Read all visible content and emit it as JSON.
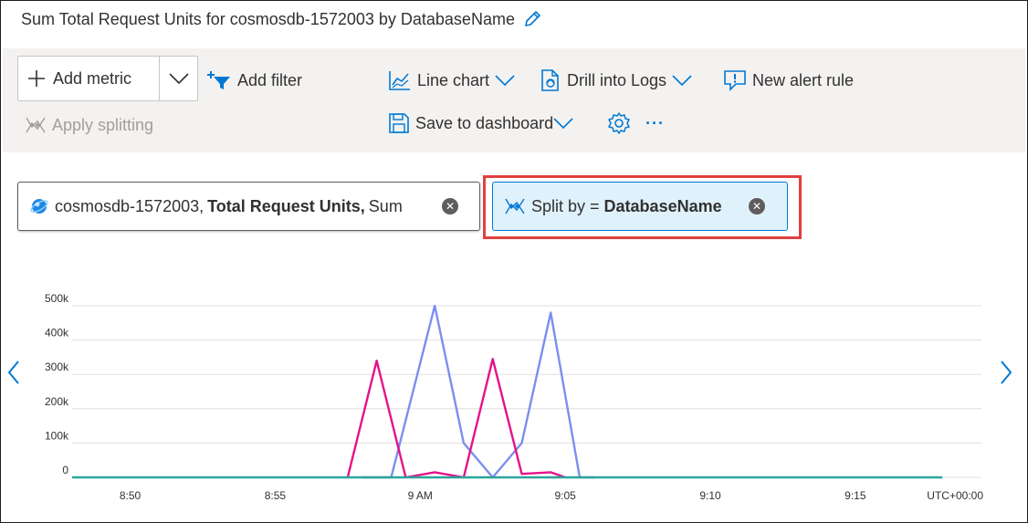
{
  "title": "Sum Total Request Units for cosmosdb-1572003 by DatabaseName",
  "toolbar": {
    "add_metric": "Add metric",
    "add_filter": "Add filter",
    "apply_splitting": "Apply splitting",
    "line_chart": "Line chart",
    "drill_into_logs": "Drill into Logs",
    "new_alert_rule": "New alert rule",
    "save_to_dashboard": "Save to dashboard",
    "more": "···"
  },
  "metric_pill": {
    "resource": "cosmosdb-1572003,",
    "metric": "Total Request Units,",
    "aggregation": "Sum"
  },
  "split_pill": {
    "prefix": "Split by =",
    "value": "DatabaseName"
  },
  "colors": {
    "accent": "#0078d4",
    "highlight": "#e0403f",
    "series_blue": "#7b8ff0",
    "series_pink": "#e3138a",
    "series_teal": "#2aa59a"
  },
  "chart_data": {
    "type": "line",
    "x": [
      "8:48",
      "8:51",
      "8:54",
      "8:57",
      "8:58",
      "8:59",
      "9:00",
      "9:01",
      "9:02",
      "9:03",
      "9:04",
      "9:05",
      "9:06",
      "9:09",
      "9:12",
      "9:15",
      "9:18"
    ],
    "x_tick_labels": [
      "8:50",
      "8:55",
      "9 AM",
      "9:05",
      "9:10",
      "9:15"
    ],
    "x_tick_positions": [
      "8:50",
      "8:55",
      "9:00",
      "9:05",
      "9:10",
      "9:15"
    ],
    "timezone_label": "UTC+00:00",
    "y_tick_labels": [
      "500k",
      "400k",
      "300k",
      "200k",
      "100k",
      "0"
    ],
    "ylim": [
      0,
      500000
    ],
    "grid": true,
    "series": [
      {
        "color": "#7b8ff0",
        "points": [
          [
            "8:58",
            0
          ],
          [
            "8:59",
            0
          ],
          [
            "9:00.5",
            500000
          ],
          [
            "9:01.5",
            100000
          ],
          [
            "9:02.5",
            0
          ],
          [
            "9:03.5",
            100000
          ],
          [
            "9:04.5",
            480000
          ],
          [
            "9:05.5",
            0
          ],
          [
            "9:06",
            0
          ]
        ]
      },
      {
        "color": "#e3138a",
        "points": [
          [
            "8:57.5",
            0
          ],
          [
            "8:58.5",
            340000
          ],
          [
            "8:59.5",
            0
          ],
          [
            "9:00.5",
            15000
          ],
          [
            "9:01.5",
            0
          ],
          [
            "9:02.5",
            345000
          ],
          [
            "9:03.5",
            10000
          ],
          [
            "9:04.5",
            15000
          ],
          [
            "9:05",
            0
          ]
        ]
      },
      {
        "color": "#2aa59a",
        "points": [
          [
            "8:48",
            0
          ],
          [
            "9:18",
            0
          ]
        ]
      }
    ]
  }
}
